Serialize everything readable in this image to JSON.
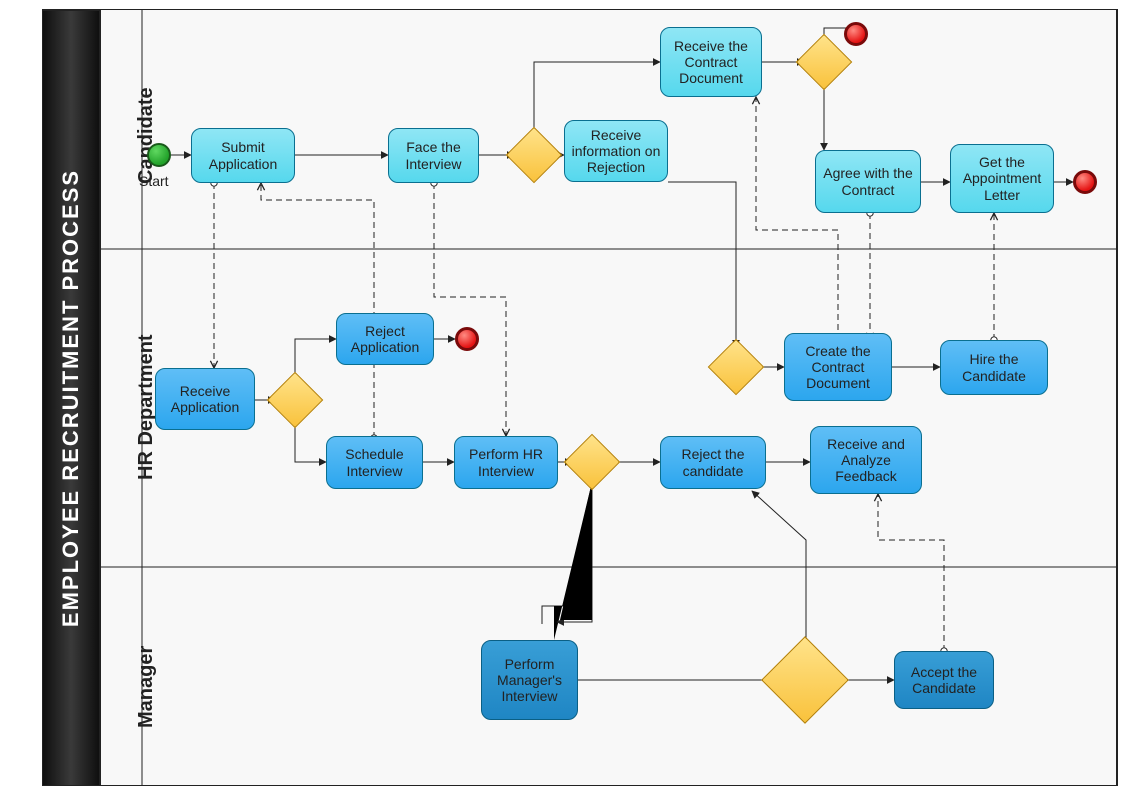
{
  "pool": {
    "title": "EMPLOYEE RECRUITMENT PROCESS"
  },
  "lanes": {
    "candidate": "Candidate",
    "hr": "HR Department",
    "manager": "Manager"
  },
  "labels": {
    "start": "Start"
  },
  "tasks": {
    "submitApplication": "Submit Application",
    "faceInterview": "Face the Interview",
    "receiveRejection": "Receive information on Rejection",
    "receiveContract": "Receive the Contract Document",
    "agreeContract": "Agree with the Contract",
    "appointmentLetter": "Get the Appointment Letter",
    "receiveApplication": "Receive Application",
    "rejectApplication": "Reject Application",
    "scheduleInterview": "Schedule Interview",
    "performHRInterview": "Perform HR Interview",
    "rejectCandidate": "Reject the candidate",
    "analyzeFeedback": "Receive and Analyze Feedback",
    "createContract": "Create the Contract Document",
    "hireCandidate": "Hire the Candidate",
    "performManagerInterview": "Perform Manager's Interview",
    "acceptCandidate": "Accept the Candidate"
  }
}
